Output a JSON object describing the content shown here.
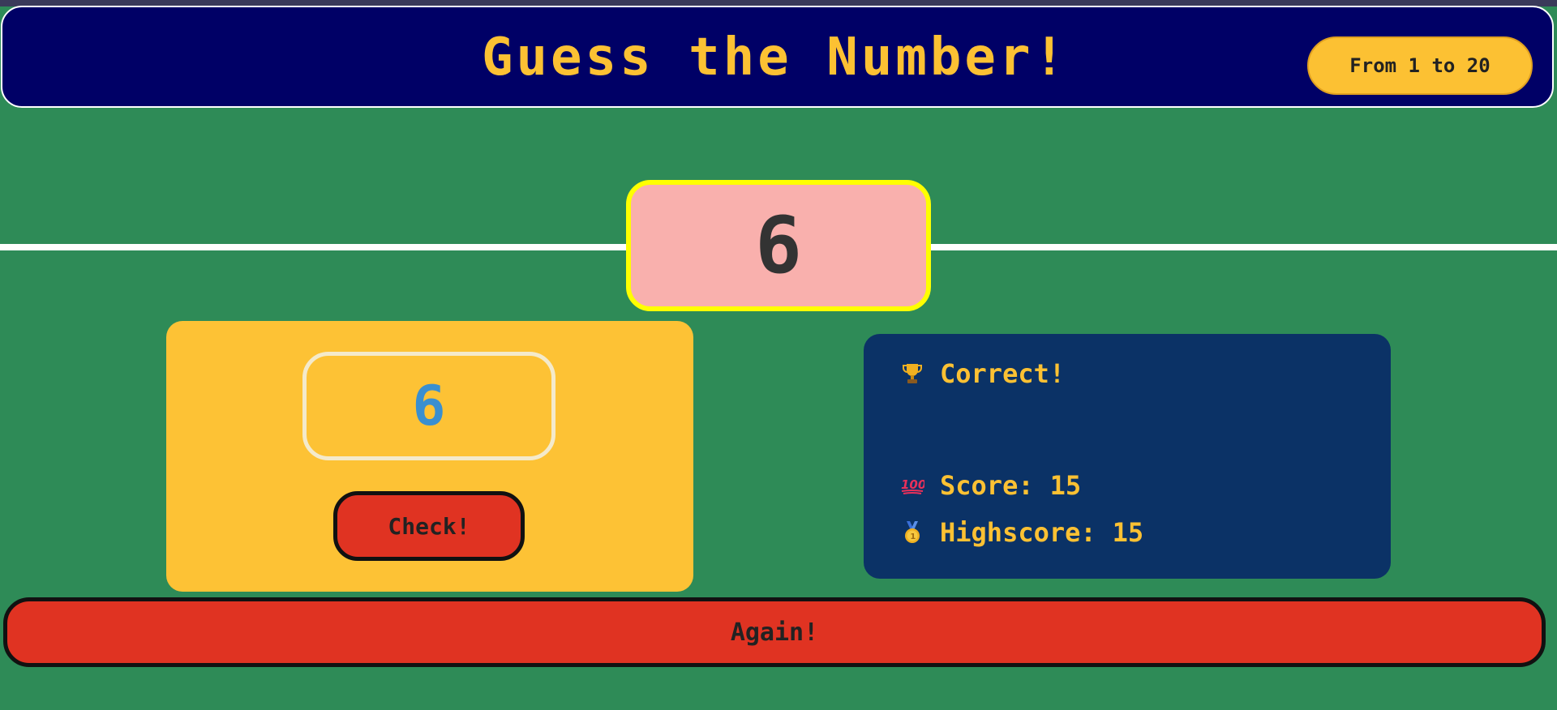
{
  "header": {
    "title": "Guess the Number!",
    "range_label": "From 1 to 20"
  },
  "secret": {
    "number": "6"
  },
  "guess": {
    "value": "6"
  },
  "controls": {
    "check_label": "Check!",
    "again_label": "Again!"
  },
  "stats": {
    "message": "Correct!",
    "message_icon": "trophy-icon",
    "score_label": "Score:",
    "score_value": "15",
    "score_icon": "hundred-points-icon",
    "highscore_label": "Highscore:",
    "highscore_value": "15",
    "highscore_icon": "medal-icon"
  },
  "colors": {
    "background": "#2e8b57",
    "header_bg": "#000066",
    "accent_yellow": "#fcc133",
    "secret_bg": "#f9b0ad",
    "secret_border": "#ffff00",
    "button_red": "#e03322",
    "stats_panel": "#0b3266",
    "guess_text": "#3a8fd0"
  }
}
